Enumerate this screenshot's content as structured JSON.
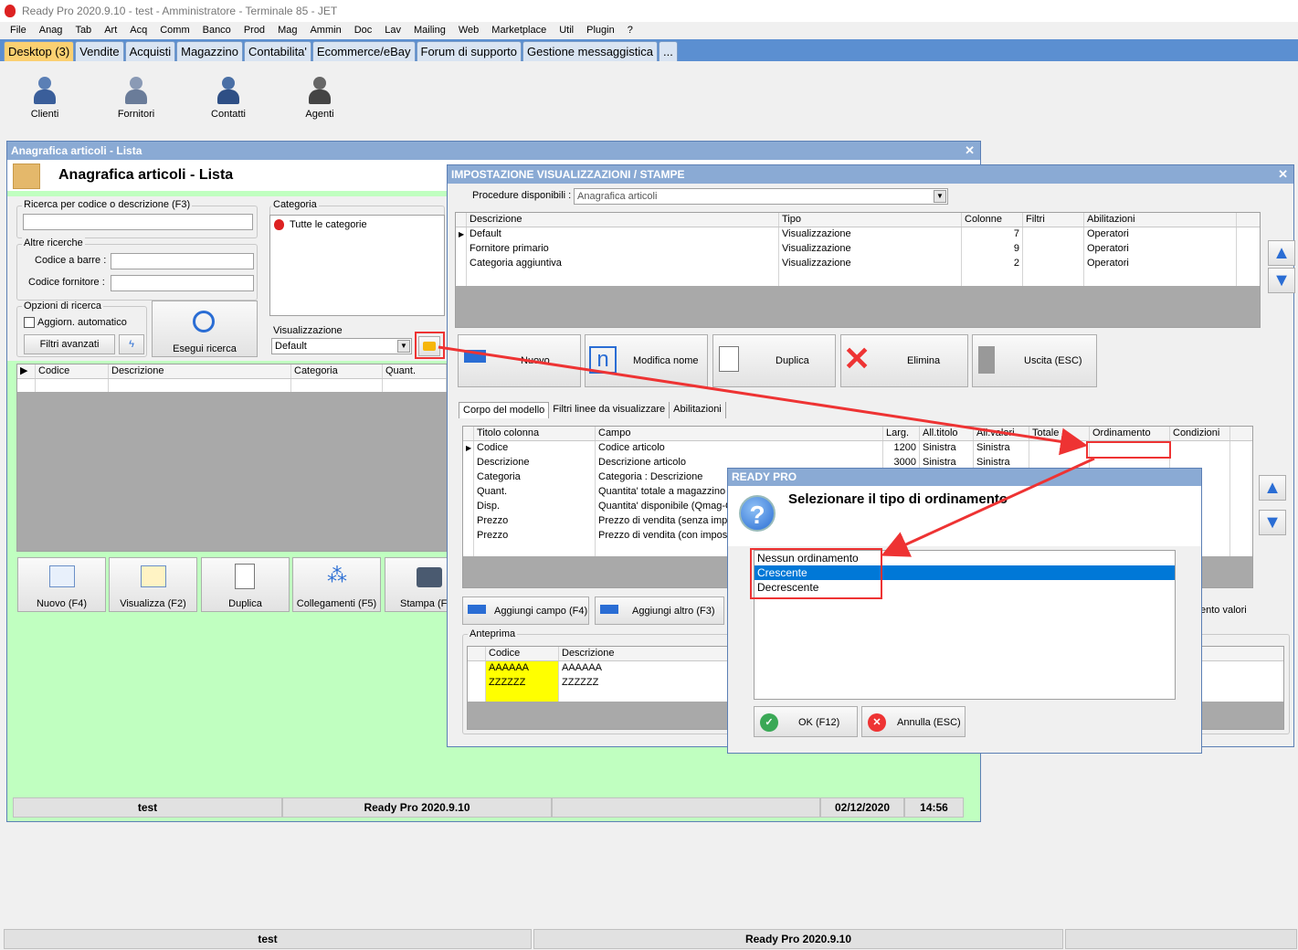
{
  "app": {
    "title": "Ready Pro 2020.9.10 - test - Amministratore - Terminale 85 - JET"
  },
  "menu": [
    "File",
    "Anag",
    "Tab",
    "Art",
    "Acq",
    "Comm",
    "Banco",
    "Prod",
    "Mag",
    "Ammin",
    "Doc",
    "Lav",
    "Mailing",
    "Web",
    "Marketplace",
    "Util",
    "Plugin",
    "?"
  ],
  "tabs": [
    "Desktop (3)",
    "Vendite",
    "Acquisti",
    "Magazzino",
    "Contabilita'",
    "Ecommerce/eBay",
    "Forum di supporto",
    "Gestione messaggistica",
    "..."
  ],
  "desktop_icons": [
    "Clienti",
    "Fornitori",
    "Contatti",
    "Agenti"
  ],
  "articoli": {
    "window_title": "Anagrafica articoli  - Lista",
    "heading": "Anagrafica articoli  - Lista",
    "search_label": "Ricerca per codice o descrizione (F3)",
    "altre_label": "Altre ricerche",
    "barcode_label": "Codice a barre :",
    "fornitore_label": "Codice fornitore :",
    "opzioni_label": "Opzioni di ricerca",
    "aggiorn_label": "Aggiorn. automatico",
    "filtri_btn": "Filtri avanzati",
    "esegui_btn": "Esegui ricerca",
    "categoria_label": "Categoria",
    "categoria_item": "Tutte le categorie",
    "visual_label": "Visualizzazione",
    "visual_value": "Default",
    "columns": [
      "Codice",
      "Descrizione",
      "Categoria",
      "Quant."
    ],
    "buttons": [
      "Nuovo (F4)",
      "Visualizza (F2)",
      "Duplica",
      "Collegamenti (F5)",
      "Stampa (F"
    ],
    "status": [
      "test",
      "Ready Pro 2020.9.10",
      "",
      "02/12/2020",
      "14:56"
    ]
  },
  "impost": {
    "title": "IMPOSTAZIONE VISUALIZZAZIONI / STAMPE",
    "proc_label": "Procedure disponibili :",
    "proc_value": "Anagrafica articoli",
    "columns": [
      "Descrizione",
      "Tipo",
      "Colonne",
      "Filtri",
      "Abilitazioni"
    ],
    "rows": [
      [
        "Default",
        "Visualizzazione",
        "7",
        "",
        "Operatori"
      ],
      [
        "Fornitore primario",
        "Visualizzazione",
        "9",
        "",
        "Operatori"
      ],
      [
        "Categoria aggiuntiva",
        "Visualizzazione",
        "2",
        "",
        "Operatori"
      ]
    ],
    "toolbar": [
      "Nuovo",
      "Modifica nome",
      "Duplica",
      "Elimina",
      "Uscita (ESC)"
    ],
    "subtabs": [
      "Corpo del modello",
      "Filtri linee da visualizzare",
      "Abilitazioni"
    ],
    "fcolumns": [
      "Titolo colonna",
      "Campo",
      "Larg.",
      "All.titolo",
      "All.valori",
      "Totale",
      "Ordinamento",
      "Condizioni"
    ],
    "frows": [
      [
        "Codice",
        "Codice articolo",
        "1200",
        "Sinistra",
        "Sinistra",
        "",
        "",
        ""
      ],
      [
        "Descrizione",
        "Descrizione articolo",
        "3000",
        "Sinistra",
        "Sinistra",
        "",
        "",
        ""
      ],
      [
        "Categoria",
        "Categoria : Descrizione",
        "",
        "",
        "",
        "",
        "",
        ""
      ],
      [
        "Quant.",
        "Quantita' totale a magazzino",
        "",
        "",
        "",
        "",
        "",
        ""
      ],
      [
        "Disp.",
        "Quantita' disponibile (Qmag-Q",
        "",
        "",
        "",
        "",
        "",
        ""
      ],
      [
        "Prezzo",
        "Prezzo di vendita (senza impo",
        "",
        "",
        "",
        "",
        "",
        ""
      ],
      [
        "Prezzo",
        "Prezzo di vendita (con impost",
        "",
        "",
        "",
        "",
        "",
        ""
      ]
    ],
    "add_campo": "Aggiungi campo (F4)",
    "add_altro": "Aggiungi altro (F3)",
    "anteprima_label": "Anteprima",
    "prev_columns": [
      "Codice",
      "Descrizione"
    ],
    "prev_rows": [
      [
        "AAAAAA",
        "AAAAAA"
      ],
      [
        "ZZZZZZ",
        "ZZZZZZ"
      ]
    ],
    "right_label": "ento valori"
  },
  "dialog": {
    "title": "READY PRO",
    "question": "Selezionare il tipo di ordinamento",
    "options": [
      "Nessun ordinamento",
      "Crescente",
      "Decrescente"
    ],
    "selected": 1,
    "ok": "OK (F12)",
    "cancel": "Annulla (ESC)"
  },
  "status": [
    "test",
    "Ready Pro 2020.9.10",
    ""
  ]
}
